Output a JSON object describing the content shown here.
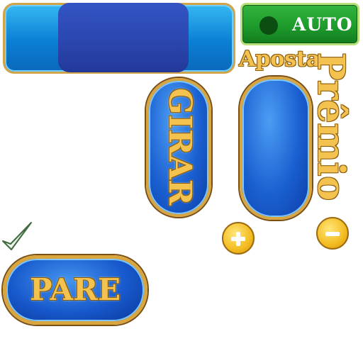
{
  "auto_button": {
    "label": "AUTO"
  },
  "labels": {
    "aposta": "Aposta",
    "premio": "Prêmio"
  },
  "spin_button": {
    "label": "GIRAR"
  },
  "stop_button": {
    "label": "PARE"
  },
  "icons": {
    "plus": "plus-icon",
    "minus": "minus-icon",
    "check": "checkmark-icon"
  },
  "colors": {
    "accent_blue": "#1a5fd0",
    "gold": "#f4c24e",
    "green": "#1e9c2c"
  }
}
